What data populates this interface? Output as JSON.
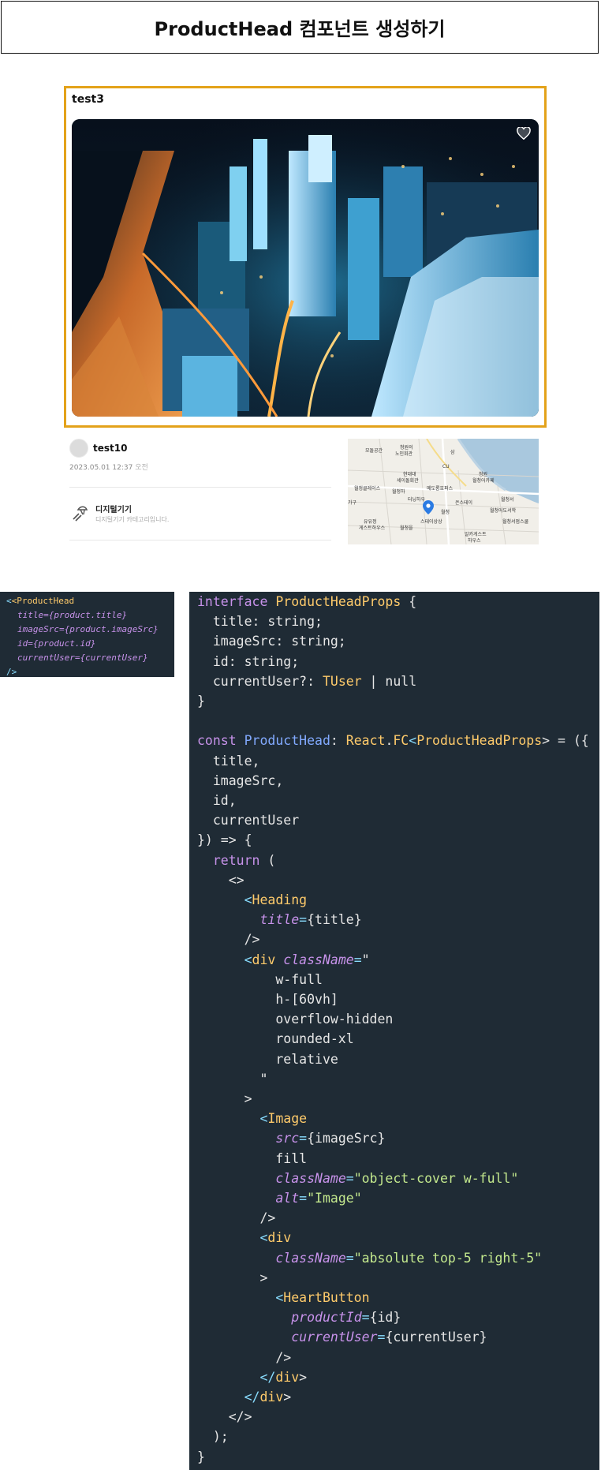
{
  "header": {
    "title": "ProductHead 컴포넌트 생성하기"
  },
  "product": {
    "title": "test3",
    "image_alt": "Image",
    "user": {
      "name": "test10"
    },
    "date": "2023.05.01 12:37",
    "ampm": "오전",
    "category": {
      "name": "디지털기기",
      "description": "디지털기기 카테고리입니다."
    }
  },
  "map": {
    "labels": [
      "모돌공간",
      "청원의",
      "노인회관",
      "삼",
      "CU",
      "현대대",
      "세이돌회관",
      "청원",
      "월청어카페",
      "월청클레이스",
      "메도롱호퍼스",
      "월청하",
      "터닝하우",
      "월청서",
      "가구",
      "스테이상상",
      "은스테이",
      "월청어도서학",
      "유유정",
      "게스트하우스",
      "월청을",
      "알카게스트",
      "하우스",
      "월청서점스쿨",
      "월청"
    ]
  },
  "snippet": {
    "lines": [
      [
        "<ProductHead"
      ],
      [
        "title={product.title}"
      ],
      [
        "imageSrc={product.imageSrc}"
      ],
      [
        "id={product.id}"
      ],
      [
        "currentUser={currentUser}"
      ],
      [
        "/>"
      ]
    ]
  },
  "code": {
    "lines": [
      "interface ProductHeadProps {",
      "  title: string;",
      "  imageSrc: string;",
      "  id: string;",
      "  currentUser?: TUser | null",
      "}",
      "",
      "const ProductHead: React.FC<ProductHeadProps> = ({",
      "  title,",
      "  imageSrc,",
      "  id,",
      "  currentUser",
      "}) => {",
      "  return (",
      "    <>",
      "      <Heading",
      "        title={title}",
      "      />",
      "      <div className=\"",
      "          w-full",
      "          h-[60vh]",
      "          overflow-hidden",
      "          rounded-xl",
      "          relative",
      "        \"",
      "      >",
      "        <Image",
      "          src={imageSrc}",
      "          fill",
      "          className=\"object-cover w-full\"",
      "          alt=\"Image\"",
      "        />",
      "        <div",
      "          className=\"absolute top-5 right-5\"",
      "        >",
      "          <HeartButton",
      "            productId={id}",
      "            currentUser={currentUser}",
      "          />",
      "        </div>",
      "      </div>",
      "    </>",
      "  );",
      "}"
    ]
  },
  "colors": {
    "frame": "#e3a21a",
    "code_bg": "#1f2b35",
    "tag": "#ffcb6b",
    "keyword": "#c792ea",
    "string": "#c3e88d"
  }
}
